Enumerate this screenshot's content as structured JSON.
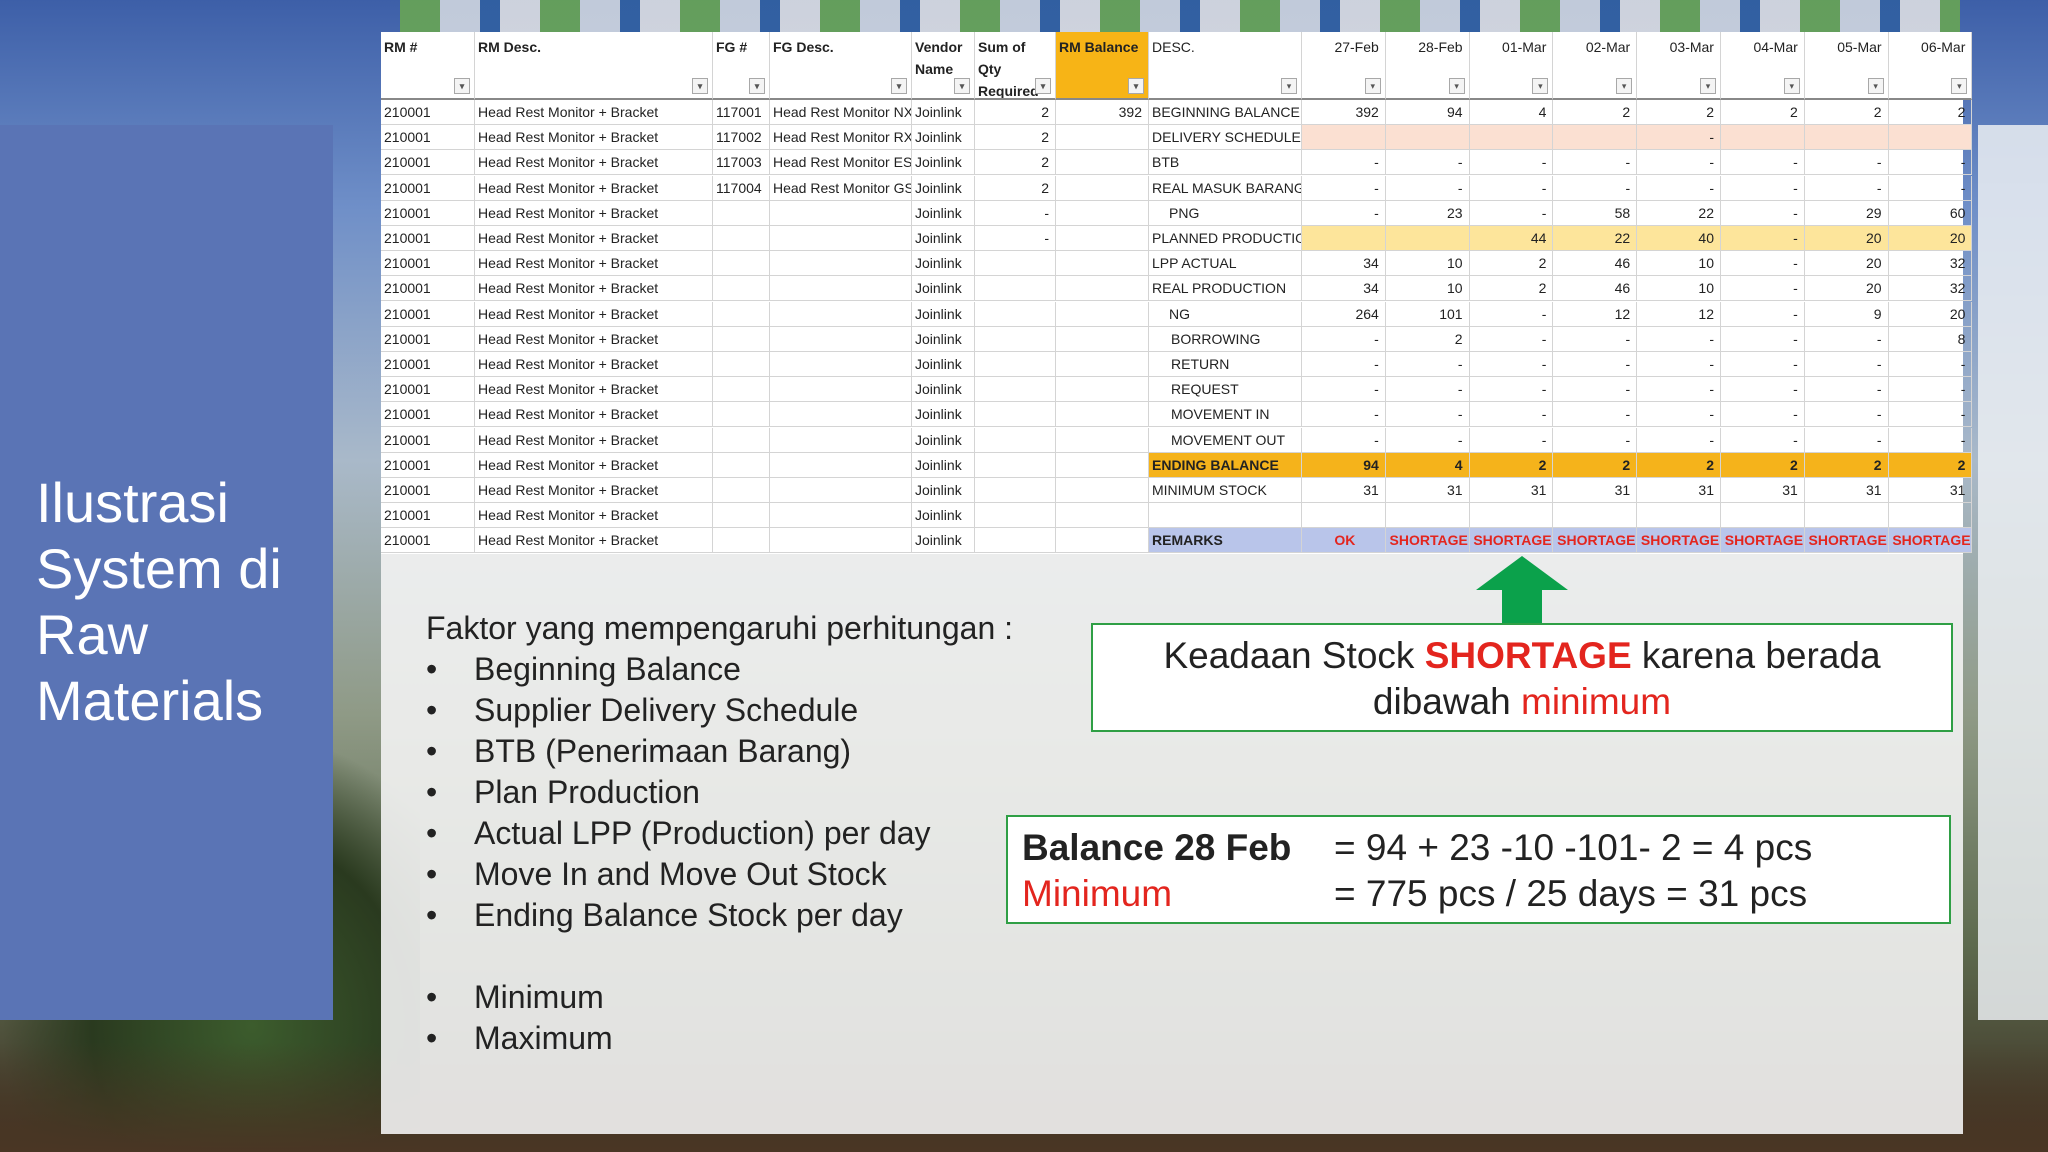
{
  "slide": {
    "title": "Ilustrasi\nSystem di\nRaw\nMaterials"
  },
  "sheet": {
    "left_headers": [
      "RM #",
      "RM Desc.",
      "FG #",
      "FG Desc.",
      "Vendor Name",
      "Sum of Qty Required",
      "RM Balance"
    ],
    "right_headers": [
      "DESC.",
      "27-Feb",
      "28-Feb",
      "01-Mar",
      "02-Mar",
      "03-Mar",
      "04-Mar",
      "05-Mar",
      "06-Mar"
    ],
    "left_rows": [
      [
        "210001",
        "Head Rest Monitor + Bracket",
        "117001",
        "Head Rest Monitor NX",
        "Joinlink",
        "2",
        "392"
      ],
      [
        "210001",
        "Head Rest Monitor + Bracket",
        "117002",
        "Head Rest Monitor RX",
        "Joinlink",
        "2",
        ""
      ],
      [
        "210001",
        "Head Rest Monitor + Bracket",
        "117003",
        "Head Rest Monitor ES",
        "Joinlink",
        "2",
        ""
      ],
      [
        "210001",
        "Head Rest Monitor + Bracket",
        "117004",
        "Head Rest Monitor GS",
        "Joinlink",
        "2",
        ""
      ],
      [
        "210001",
        "Head Rest Monitor + Bracket",
        "",
        "",
        "Joinlink",
        "-",
        ""
      ],
      [
        "210001",
        "Head Rest Monitor + Bracket",
        "",
        "",
        "Joinlink",
        "-",
        ""
      ],
      [
        "210001",
        "Head Rest Monitor + Bracket",
        "",
        "",
        "Joinlink",
        "",
        ""
      ],
      [
        "210001",
        "Head Rest Monitor + Bracket",
        "",
        "",
        "Joinlink",
        "",
        ""
      ],
      [
        "210001",
        "Head Rest Monitor + Bracket",
        "",
        "",
        "Joinlink",
        "",
        ""
      ],
      [
        "210001",
        "Head Rest Monitor + Bracket",
        "",
        "",
        "Joinlink",
        "",
        ""
      ],
      [
        "210001",
        "Head Rest Monitor + Bracket",
        "",
        "",
        "Joinlink",
        "",
        ""
      ],
      [
        "210001",
        "Head Rest Monitor + Bracket",
        "",
        "",
        "Joinlink",
        "",
        ""
      ],
      [
        "210001",
        "Head Rest Monitor + Bracket",
        "",
        "",
        "Joinlink",
        "",
        ""
      ],
      [
        "210001",
        "Head Rest Monitor + Bracket",
        "",
        "",
        "Joinlink",
        "",
        ""
      ],
      [
        "210001",
        "Head Rest Monitor + Bracket",
        "",
        "",
        "Joinlink",
        "",
        ""
      ],
      [
        "210001",
        "Head Rest Monitor + Bracket",
        "",
        "",
        "Joinlink",
        "",
        ""
      ],
      [
        "210001",
        "Head Rest Monitor + Bracket",
        "",
        "",
        "Joinlink",
        "",
        ""
      ],
      [
        "210001",
        "Head Rest Monitor + Bracket",
        "",
        "",
        "Joinlink",
        "",
        ""
      ]
    ],
    "right_rows": [
      {
        "desc": "BEGINNING BALANCE",
        "style": "",
        "indent": 0,
        "values": [
          "392",
          "94",
          "4",
          "2",
          "2",
          "2",
          "2",
          "2"
        ]
      },
      {
        "desc": "DELIVERY SCHEDULE",
        "style": "peach",
        "indent": 0,
        "values": [
          "",
          "",
          "",
          "",
          "-",
          "",
          "",
          ""
        ]
      },
      {
        "desc": "BTB",
        "style": "",
        "indent": 0,
        "values": [
          "-",
          "-",
          "-",
          "-",
          "-",
          "-",
          "-",
          "-"
        ]
      },
      {
        "desc": "REAL MASUK BARANG",
        "style": "",
        "indent": 0,
        "values": [
          "-",
          "-",
          "-",
          "-",
          "-",
          "-",
          "-",
          "-"
        ]
      },
      {
        "desc": "PNG",
        "style": "",
        "indent": 1,
        "values": [
          "-",
          "23",
          "-",
          "58",
          "22",
          "-",
          "29",
          "60"
        ]
      },
      {
        "desc": "PLANNED PRODUCTION",
        "style": "yellow",
        "indent": 0,
        "values": [
          "",
          "",
          "44",
          "22",
          "40",
          "-",
          "20",
          "20"
        ]
      },
      {
        "desc": "LPP ACTUAL",
        "style": "",
        "indent": 0,
        "values": [
          "34",
          "10",
          "2",
          "46",
          "10",
          "-",
          "20",
          "32"
        ]
      },
      {
        "desc": "REAL PRODUCTION",
        "style": "",
        "indent": 0,
        "values": [
          "34",
          "10",
          "2",
          "46",
          "10",
          "-",
          "20",
          "32"
        ]
      },
      {
        "desc": "NG",
        "style": "",
        "indent": 1,
        "values": [
          "264",
          "101",
          "-",
          "12",
          "12",
          "-",
          "9",
          "20"
        ]
      },
      {
        "desc": "BORROWING",
        "style": "",
        "indent": 2,
        "values": [
          "-",
          "2",
          "-",
          "-",
          "-",
          "-",
          "-",
          "8"
        ]
      },
      {
        "desc": "RETURN",
        "style": "",
        "indent": 2,
        "values": [
          "-",
          "-",
          "-",
          "-",
          "-",
          "-",
          "-",
          "-"
        ]
      },
      {
        "desc": "REQUEST",
        "style": "",
        "indent": 2,
        "values": [
          "-",
          "-",
          "-",
          "-",
          "-",
          "-",
          "-",
          "-"
        ]
      },
      {
        "desc": "MOVEMENT IN",
        "style": "",
        "indent": 2,
        "values": [
          "-",
          "-",
          "-",
          "-",
          "-",
          "-",
          "-",
          "-"
        ]
      },
      {
        "desc": "MOVEMENT OUT",
        "style": "",
        "indent": 2,
        "values": [
          "-",
          "-",
          "-",
          "-",
          "-",
          "-",
          "-",
          "-"
        ]
      },
      {
        "desc": "ENDING BALANCE",
        "style": "orange",
        "indent": 0,
        "values": [
          "94",
          "4",
          "2",
          "2",
          "2",
          "2",
          "2",
          "2"
        ]
      },
      {
        "desc": "MINIMUM STOCK",
        "style": "",
        "indent": 0,
        "values": [
          "31",
          "31",
          "31",
          "31",
          "31",
          "31",
          "31",
          "31"
        ]
      },
      {
        "desc": "",
        "style": "",
        "indent": 0,
        "values": [
          "",
          "",
          "",
          "",
          "",
          "",
          "",
          ""
        ]
      },
      {
        "desc": "REMARKS",
        "style": "remarks",
        "indent": 0,
        "values": [
          "OK",
          "SHORTAGE",
          "SHORTAGE",
          "SHORTAGE",
          "SHORTAGE",
          "SHORTAGE",
          "SHORTAGE",
          "SHORTAGE"
        ]
      }
    ]
  },
  "factors": {
    "heading": "Faktor yang mempengaruhi perhitungan :",
    "bullet_char": "•",
    "items": [
      "Beginning Balance",
      "Supplier Delivery Schedule",
      "BTB (Penerimaan Barang)",
      "Plan Production",
      "Actual LPP (Production) per day",
      "Move In and Move Out Stock",
      "Ending Balance Stock per day"
    ],
    "items2": [
      "Minimum",
      "Maximum"
    ]
  },
  "callout": {
    "prefix": "Keadaan Stock ",
    "shortage": "SHORTAGE",
    "middle": " karena berada",
    "line2_prefix": "dibawah ",
    "minimum": "minimum"
  },
  "formula": {
    "balance_label": "Balance 28 Feb",
    "balance_value": "= 94 + 23 -10 -101- 2 = 4 pcs",
    "minimum_label": "Minimum",
    "minimum_value": "= 775 pcs / 25 days = 31 pcs"
  },
  "colors": {
    "panel_blue": "#5a74b5",
    "rm_balance_header": "#f7b416",
    "ending_balance": "#f5b31b",
    "planned_production": "#fde59b",
    "delivery_schedule": "#fbe0d2",
    "remarks": "#b9c5ea",
    "shortage_red": "#e3251e",
    "box_border_green": "#2f9f45",
    "arrow_green": "#0ba14b"
  },
  "icons": {
    "filter": "filter-dropdown-icon",
    "arrow": "up-arrow-icon"
  }
}
